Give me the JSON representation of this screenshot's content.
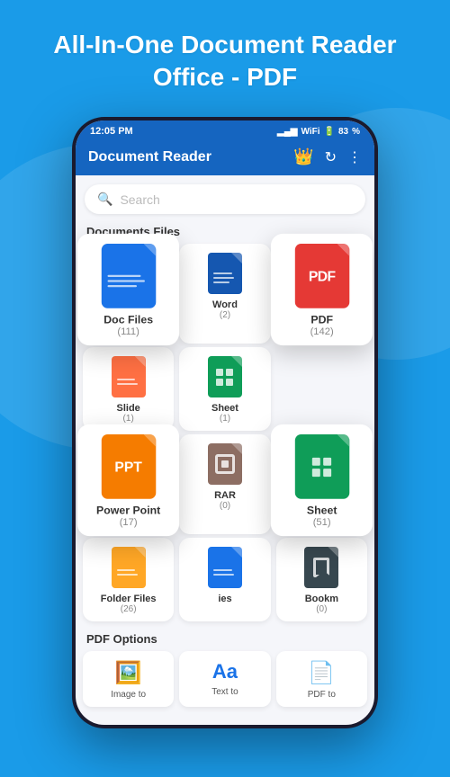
{
  "app": {
    "title": "All-In-One Document Reader Office - PDF",
    "name": "Document Reader"
  },
  "status_bar": {
    "time": "12:05 PM",
    "battery": "83",
    "signal": "▂▄▆",
    "wifi": "WiFi"
  },
  "search": {
    "placeholder": "Search"
  },
  "sections": {
    "documents": "Documents Files",
    "pdf_options": "PDF Options"
  },
  "doc_files": [
    {
      "id": "doc",
      "label": "Doc Files",
      "count": "(111)",
      "color": "blue",
      "type": "lines"
    },
    {
      "id": "word",
      "label": "Word",
      "count": "(2)",
      "color": "blue-dark",
      "type": "lines"
    },
    {
      "id": "pdf",
      "label": "PDF",
      "count": "(142)",
      "color": "red",
      "type": "text",
      "text": "PDF",
      "large": true
    },
    {
      "id": "slide",
      "label": "Slide",
      "count": "(1)",
      "color": "orange",
      "type": "lines"
    },
    {
      "id": "sheet-sm",
      "label": "Sheet",
      "count": "(1)",
      "color": "green",
      "type": "grid"
    },
    {
      "id": "powerpoint",
      "label": "Power Point",
      "count": "(17)",
      "color": "orange",
      "type": "text",
      "text": "PPT",
      "large": true
    },
    {
      "id": "rar",
      "label": "RAR",
      "count": "(0)",
      "color": "brown",
      "type": "rar"
    },
    {
      "id": "sheet-lg",
      "label": "Sheet",
      "count": "(51)",
      "color": "green",
      "type": "grid",
      "large": true
    },
    {
      "id": "folder",
      "label": "Folder Files",
      "count": "(26)",
      "color": "orange",
      "type": "lines"
    },
    {
      "id": "files",
      "label": "ies",
      "count": "()",
      "color": "blue",
      "type": "lines"
    },
    {
      "id": "bookmark",
      "label": "Bookm",
      "count": "(0)",
      "color": "dark-blue",
      "type": "bookmark"
    }
  ],
  "pdf_options": [
    {
      "id": "image-to",
      "label": "Image to",
      "icon": "🖼️"
    },
    {
      "id": "text-to",
      "label": "Text to",
      "icon": "Aa"
    },
    {
      "id": "pdf-to",
      "label": "PDF to",
      "icon": "📄"
    }
  ],
  "colors": {
    "primary": "#1a9be8",
    "app_bar": "#1565c0",
    "crown": "#FFD700"
  }
}
